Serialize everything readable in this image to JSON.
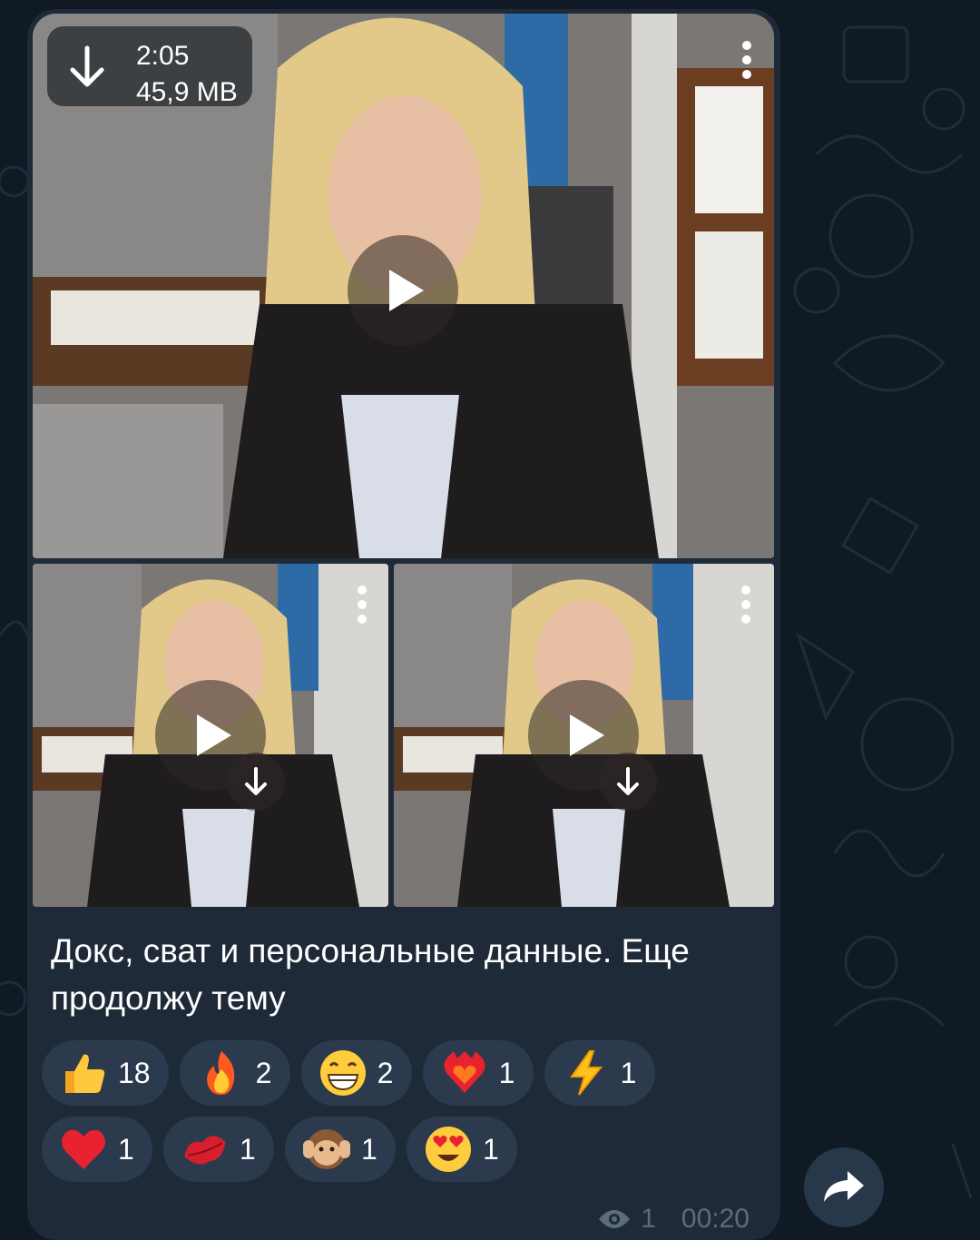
{
  "post": {
    "duration": "2:05",
    "size": "45,9 MB",
    "caption": "Докс, сват и персональные данные. Еще продолжу тему",
    "views": "1",
    "time": "00:20"
  },
  "reactions": [
    [
      {
        "emoji": "thumbs-up",
        "count": "18"
      },
      {
        "emoji": "fire",
        "count": "2"
      },
      {
        "emoji": "grin",
        "count": "2"
      },
      {
        "emoji": "heart-on-fire",
        "count": "1"
      },
      {
        "emoji": "lightning",
        "count": "1"
      }
    ],
    [
      {
        "emoji": "red-heart",
        "count": "1"
      },
      {
        "emoji": "kiss-mark",
        "count": "1"
      },
      {
        "emoji": "hear-no-evil-monkey",
        "count": "1"
      },
      {
        "emoji": "heart-eyes",
        "count": "1"
      }
    ]
  ],
  "colors": {
    "background": "#0f1a24",
    "bubble": "#1f2a38",
    "reaction_pill": "#2b3a4d",
    "meta_text": "#5c6c7d"
  }
}
